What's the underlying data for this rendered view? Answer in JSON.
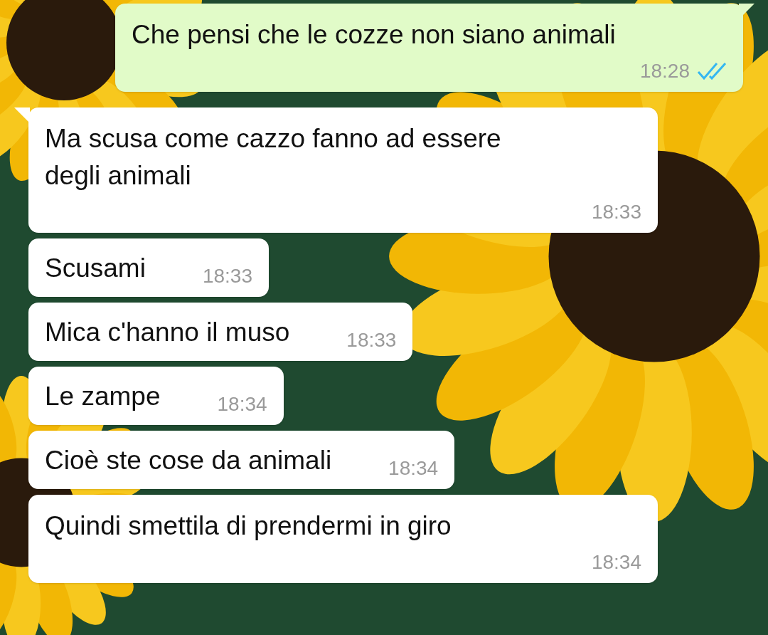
{
  "messages": [
    {
      "outgoing": true,
      "kind": "stacked",
      "text": "Che pensi che le cozze non siano animali",
      "time": "18:28",
      "read": true,
      "tail": true
    },
    {
      "outgoing": false,
      "kind": "stacked",
      "text": "Ma scusa come cazzo fanno ad essere degli animali",
      "time": "18:33",
      "tail": true
    },
    {
      "outgoing": false,
      "kind": "inline",
      "text": "Scusami",
      "time": "18:33",
      "tail": false
    },
    {
      "outgoing": false,
      "kind": "inline",
      "text": "Mica c'hanno il muso",
      "time": "18:33",
      "tail": false
    },
    {
      "outgoing": false,
      "kind": "inline",
      "text": "Le zampe",
      "time": "18:34",
      "tail": false
    },
    {
      "outgoing": false,
      "kind": "inline",
      "text": "Cioè ste cose da animali",
      "time": "18:34",
      "tail": false
    },
    {
      "outgoing": false,
      "kind": "stacked",
      "text": "Quindi smettila di prendermi in giro",
      "time": "18:34",
      "tail": false
    }
  ]
}
